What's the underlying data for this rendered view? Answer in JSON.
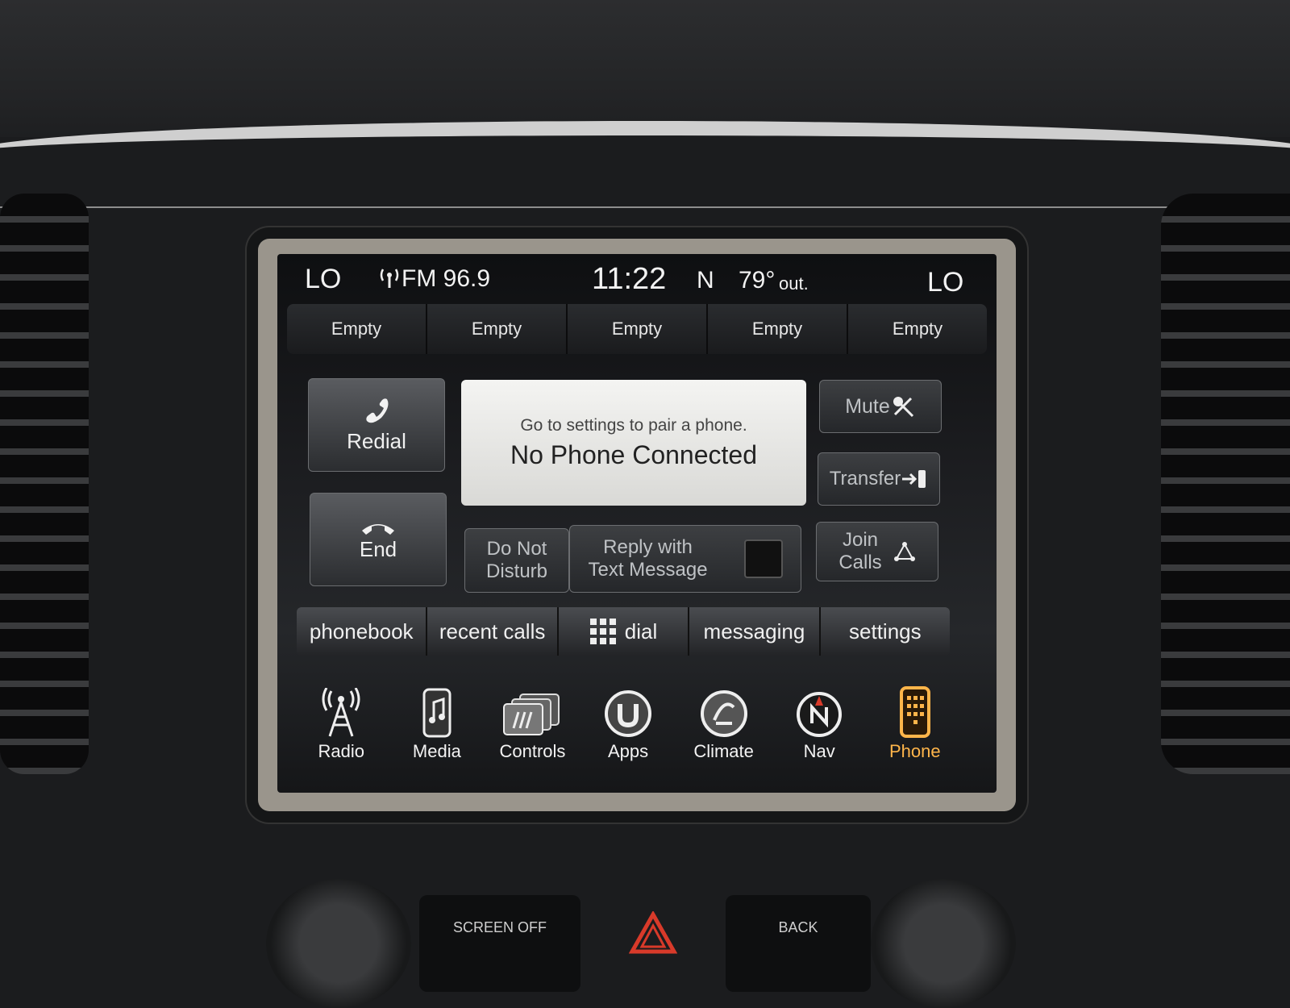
{
  "statusbar": {
    "left_temp": "LO",
    "radio": "FM 96.9",
    "time": "11:22",
    "compass": "N",
    "outside_temp": "79°",
    "outside_label": "out.",
    "right_temp": "LO"
  },
  "presets": [
    "Empty",
    "Empty",
    "Empty",
    "Empty",
    "Empty"
  ],
  "phone": {
    "redial": "Redial",
    "end": "End",
    "mute": "Mute",
    "transfer": "Transfer",
    "join_calls_line1": "Join",
    "join_calls_line2": "Calls",
    "do_not_disturb_line1": "Do Not",
    "do_not_disturb_line2": "Disturb",
    "reply_line1": "Reply with",
    "reply_line2": "Text Message",
    "message_sub": "Go to settings to pair a phone.",
    "message_main": "No Phone Connected"
  },
  "tabs": [
    "phonebook",
    "recent calls",
    "dial",
    "messaging",
    "settings"
  ],
  "nav": [
    {
      "label": "Radio",
      "icon": "radio-tower-icon"
    },
    {
      "label": "Media",
      "icon": "media-phone-icon"
    },
    {
      "label": "Controls",
      "icon": "controls-icon"
    },
    {
      "label": "Apps",
      "icon": "apps-icon"
    },
    {
      "label": "Climate",
      "icon": "climate-icon"
    },
    {
      "label": "Nav",
      "icon": "compass-icon"
    },
    {
      "label": "Phone",
      "icon": "phone-keypad-icon"
    }
  ],
  "active_nav": "Phone",
  "console": {
    "screen_off": "SCREEN OFF",
    "back": "BACK"
  },
  "colors": {
    "accent": "#ffb54a",
    "hazard": "#d83a2a"
  }
}
